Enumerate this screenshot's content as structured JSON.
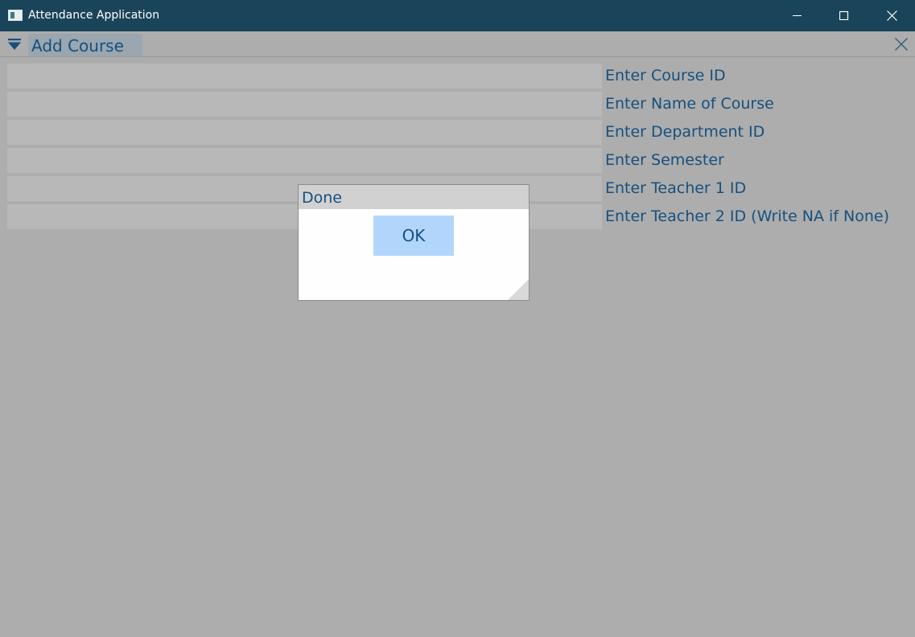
{
  "window": {
    "title": "Attendance Application",
    "minimize_icon": "minimize-icon",
    "maximize_icon": "maximize-icon",
    "close_icon": "close-icon"
  },
  "tabbar": {
    "menu_icon": "dropdown-triangle-icon",
    "active_tab": "Add Course",
    "close_icon": "close-icon"
  },
  "form": {
    "fields": [
      {
        "label": "Enter Course ID",
        "value": ""
      },
      {
        "label": "Enter Name of Course",
        "value": ""
      },
      {
        "label": "Enter Department ID",
        "value": ""
      },
      {
        "label": "Enter Semester",
        "value": ""
      },
      {
        "label": "Enter Teacher 1 ID",
        "value": ""
      },
      {
        "label": "Enter Teacher 2 ID (Write NA if None)",
        "value": ""
      }
    ]
  },
  "dialog": {
    "title": "Done",
    "ok_label": "OK"
  },
  "colors": {
    "titlebar": "#1a4459",
    "accent_text": "#16507f",
    "ok_button": "#b2d6fb",
    "background": "#adadad"
  }
}
